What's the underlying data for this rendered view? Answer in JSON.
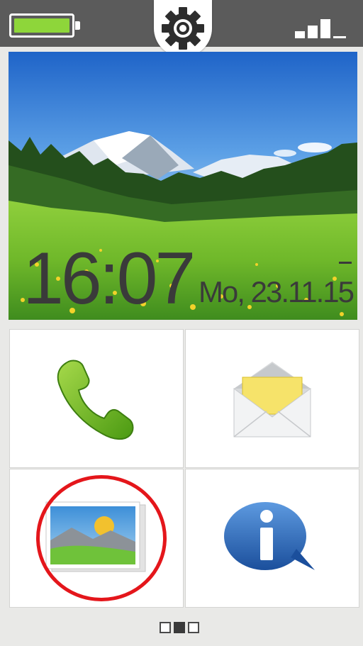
{
  "status_bar": {
    "battery_level": 1.0,
    "battery_color": "#8ed63a",
    "settings_icon": "gear-icon",
    "signal_strength_bars": 3
  },
  "lock_screen": {
    "time": "16:07",
    "date": "Mo, 23.11.15",
    "alarm_indicator": "–"
  },
  "apps": [
    {
      "name": "phone",
      "icon": "phone-icon"
    },
    {
      "name": "messages",
      "icon": "envelope-icon"
    },
    {
      "name": "gallery",
      "icon": "picture-icon",
      "highlighted": true
    },
    {
      "name": "info",
      "icon": "info-bubble-icon"
    }
  ],
  "pager": {
    "pages": 3,
    "current": 2
  },
  "colors": {
    "highlight": "#e4161b",
    "status_bar": "#5b5b5b"
  }
}
